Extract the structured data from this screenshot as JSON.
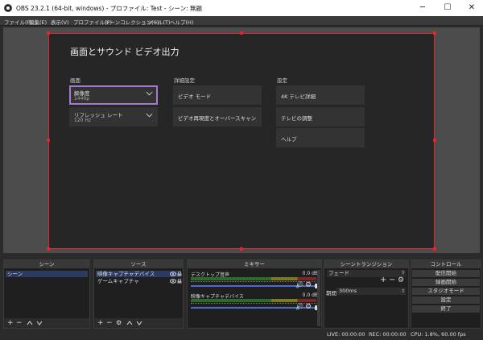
{
  "window": {
    "title": "OBS 23.2.1 (64-bit, windows) - プロファイル: Test - シーン: 無題",
    "controls": {
      "minimize": "─",
      "maximize": "☐",
      "close": "✕"
    }
  },
  "menu": [
    "ファイル(F)",
    "編集(E)",
    "表示(V)",
    "プロファイル(P)",
    "シーンコレクション(S)",
    "ツール(T)",
    "ヘルプ(H)"
  ],
  "preview": {
    "heading": "画面とサウンド ビデオ出力",
    "sections": {
      "screen": {
        "label": "画面",
        "items": [
          {
            "title": "解像度",
            "subtitle": "1440p"
          },
          {
            "title": "リフレッシュ レート",
            "subtitle": "120 Hz"
          }
        ]
      },
      "advanced": {
        "label": "詳細設定",
        "items": [
          {
            "title": "ビデオ モード"
          },
          {
            "title": "ビデオ再現度とオーバースキャン"
          }
        ]
      },
      "settings": {
        "label": "設定",
        "items": [
          {
            "title": "4K テレビ詳細"
          },
          {
            "title": "テレビの調整"
          },
          {
            "title": "ヘルプ"
          }
        ]
      }
    }
  },
  "docks": {
    "scenes": {
      "title": "シーン",
      "items": [
        "シーン"
      ]
    },
    "sources": {
      "title": "ソース",
      "items": [
        "映像キャプチャデバイス",
        "ゲームキャプチャ"
      ]
    },
    "mixer": {
      "title": "ミキサー",
      "channels": [
        {
          "name": "デスクトップ音声",
          "db": "0.0 dB",
          "volume_level": 1.0
        },
        {
          "name": "映像キャプチャデバイス",
          "db": "0.0 dB",
          "volume_level": 1.0
        }
      ]
    },
    "transitions": {
      "title": "シーントランジション",
      "selected": "フェード",
      "duration_label": "期間",
      "duration_value": "300ms"
    },
    "controls": {
      "title": "コントロール",
      "buttons": [
        "配信開始",
        "録画開始",
        "スタジオモード",
        "設定",
        "終了"
      ]
    }
  },
  "status": {
    "live": "LIVE: 00:00:00",
    "rec": "REC: 00:00:00",
    "cpu": "CPU: 1.8%, 60.00 fps"
  },
  "colors": {
    "selection": "#e1252b",
    "focus": "#a679cf",
    "slider": "#4b6cc7"
  },
  "icons": {
    "tile_chevron": "chevron-down-icon",
    "visibility": "eye-icon",
    "lock": "lock-icon",
    "speaker": "speaker-icon",
    "gear": "gear-icon"
  }
}
